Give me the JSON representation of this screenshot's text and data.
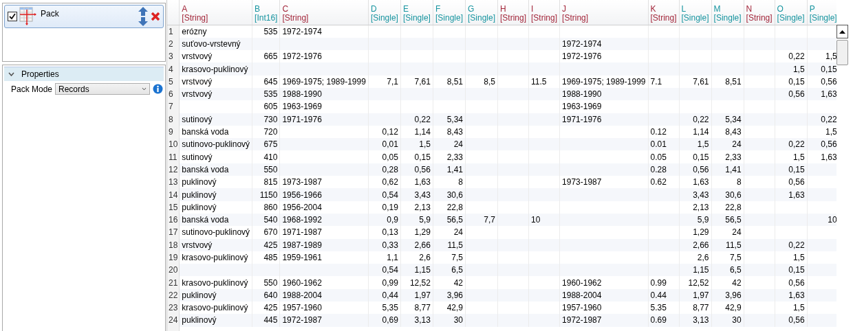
{
  "pack_list": {
    "items": [
      {
        "label": "Pack",
        "checked": true,
        "selected": true
      }
    ]
  },
  "properties": {
    "title": "Properties",
    "expanded": true,
    "fields": [
      {
        "label": "Pack Mode",
        "value": "Records"
      }
    ]
  },
  "table": {
    "columns": [
      {
        "letter": "A",
        "type": "[String]",
        "kind": "string"
      },
      {
        "letter": "B",
        "type": "[Int16]",
        "kind": "number"
      },
      {
        "letter": "C",
        "type": "[String]",
        "kind": "string"
      },
      {
        "letter": "D",
        "type": "[Single]",
        "kind": "number"
      },
      {
        "letter": "E",
        "type": "[Single]",
        "kind": "number"
      },
      {
        "letter": "F",
        "type": "[Single]",
        "kind": "number"
      },
      {
        "letter": "G",
        "type": "[Single]",
        "kind": "number"
      },
      {
        "letter": "H",
        "type": "[String]",
        "kind": "string"
      },
      {
        "letter": "I",
        "type": "[String]",
        "kind": "string"
      },
      {
        "letter": "J",
        "type": "[String]",
        "kind": "string"
      },
      {
        "letter": "K",
        "type": "[String]",
        "kind": "string"
      },
      {
        "letter": "L",
        "type": "[Single]",
        "kind": "number"
      },
      {
        "letter": "M",
        "type": "[Single]",
        "kind": "number"
      },
      {
        "letter": "N",
        "type": "[String]",
        "kind": "string"
      },
      {
        "letter": "O",
        "type": "[Single]",
        "kind": "number"
      },
      {
        "letter": "P",
        "type": "[Single]",
        "kind": "number"
      }
    ],
    "rows": [
      {
        "number": "1",
        "cells": [
          "erózny",
          "535",
          "1972-1974",
          null,
          null,
          null,
          null,
          null,
          null,
          null,
          null,
          null,
          null,
          null,
          null,
          null
        ]
      },
      {
        "number": "2",
        "cells": [
          "suťovo-vrstevný",
          null,
          null,
          null,
          null,
          null,
          null,
          null,
          null,
          "1972-1974",
          null,
          null,
          null,
          null,
          null,
          null
        ]
      },
      {
        "number": "3",
        "cells": [
          "vrstvový",
          "665",
          "1972-1976",
          null,
          null,
          null,
          null,
          null,
          null,
          "1972-1976",
          null,
          null,
          null,
          null,
          "0,22",
          "1,5"
        ]
      },
      {
        "number": "4",
        "cells": [
          "krasovo-puklinový",
          null,
          null,
          null,
          null,
          null,
          null,
          null,
          null,
          null,
          null,
          null,
          null,
          null,
          "1,5",
          "0,15"
        ]
      },
      {
        "number": "5",
        "cells": [
          "vrstvový",
          "645",
          "1969-1975; 1989-1999",
          "7,1",
          "7,61",
          "8,51",
          "8,5",
          null,
          "11.5",
          "1969-1975; 1989-1999",
          "7.1",
          "7,61",
          "8,51",
          null,
          "0,15",
          "0,56"
        ]
      },
      {
        "number": "6",
        "cells": [
          "vrstvový",
          "535",
          "1988-1990",
          null,
          null,
          null,
          null,
          null,
          null,
          "1988-1990",
          null,
          null,
          null,
          null,
          "0,56",
          "1,63"
        ]
      },
      {
        "number": "7",
        "cells": [
          null,
          "605",
          "1963-1969",
          null,
          null,
          null,
          null,
          null,
          null,
          "1963-1969",
          null,
          null,
          null,
          null,
          null,
          null
        ]
      },
      {
        "number": "8",
        "cells": [
          "sutinový",
          "730",
          "1971-1976",
          null,
          "0,22",
          "5,34",
          null,
          null,
          null,
          "1971-1976",
          null,
          "0,22",
          "5,34",
          null,
          null,
          "0,22"
        ]
      },
      {
        "number": "9",
        "cells": [
          "banská voda",
          "720",
          null,
          "0,12",
          "1,14",
          "8,43",
          null,
          null,
          null,
          null,
          "0.12",
          "1,14",
          "8,43",
          null,
          null,
          "1,5"
        ]
      },
      {
        "number": "10",
        "cells": [
          "sutinovo-puklinový",
          "675",
          null,
          "0,01",
          "1,5",
          "24",
          null,
          null,
          null,
          null,
          "0.01",
          "1,5",
          "24",
          null,
          "0,22",
          "0,56"
        ]
      },
      {
        "number": "11",
        "cells": [
          "sutinový",
          "410",
          null,
          "0,05",
          "0,15",
          "2,33",
          null,
          null,
          null,
          null,
          "0.05",
          "0,15",
          "2,33",
          null,
          "1,5",
          "1,63"
        ]
      },
      {
        "number": "12",
        "cells": [
          "banská voda",
          "550",
          null,
          "0,28",
          "0,56",
          "1,41",
          null,
          null,
          null,
          null,
          "0.28",
          "0,56",
          "1,41",
          null,
          "0,15",
          null
        ]
      },
      {
        "number": "13",
        "cells": [
          "puklinový",
          "815",
          "1973-1987",
          "0,62",
          "1,63",
          "8",
          null,
          null,
          null,
          "1973-1987",
          "0.62",
          "1,63",
          "8",
          null,
          "0,56",
          null
        ]
      },
      {
        "number": "14",
        "cells": [
          "puklinový",
          "1150",
          "1956-1966",
          "0,54",
          "3,43",
          "30,6",
          null,
          null,
          null,
          null,
          null,
          "3,43",
          "30,6",
          null,
          "1,63",
          null
        ]
      },
      {
        "number": "15",
        "cells": [
          "puklinový",
          "860",
          "1956-2004",
          "0,19",
          "2,13",
          "22,8",
          null,
          null,
          null,
          null,
          null,
          "2,13",
          "22,8",
          null,
          null,
          null
        ]
      },
      {
        "number": "16",
        "cells": [
          "banská voda",
          "540",
          "1968-1992",
          "0,9",
          "5,9",
          "56,5",
          "7,7",
          null,
          "10",
          null,
          null,
          "5,9",
          "56,5",
          null,
          null,
          "10"
        ]
      },
      {
        "number": "17",
        "cells": [
          "sutinovo-puklinový",
          "670",
          "1971-1987",
          "0,13",
          "1,29",
          "24",
          null,
          null,
          null,
          null,
          null,
          "1,29",
          "24",
          null,
          null,
          null
        ]
      },
      {
        "number": "18",
        "cells": [
          "vrstvový",
          "425",
          "1987-1989",
          "0,33",
          "2,66",
          "11,5",
          null,
          null,
          null,
          null,
          null,
          "2,66",
          "11,5",
          null,
          "0,22",
          null
        ]
      },
      {
        "number": "19",
        "cells": [
          "krasovo-puklinový",
          "485",
          "1959-1961",
          "1,1",
          "2,6",
          "7,5",
          null,
          null,
          null,
          null,
          null,
          "2,6",
          "7,5",
          null,
          "1,5",
          null
        ]
      },
      {
        "number": "20",
        "cells": [
          null,
          null,
          null,
          "0,54",
          "1,15",
          "6,5",
          null,
          null,
          null,
          null,
          null,
          "1,15",
          "6,5",
          null,
          "0,15",
          null
        ]
      },
      {
        "number": "21",
        "cells": [
          "krasovo-puklinový",
          "550",
          "1960-1962",
          "0,99",
          "12,52",
          "42",
          null,
          null,
          null,
          "1960-1962",
          "0.99",
          "12,52",
          "42",
          null,
          "0,56",
          null
        ]
      },
      {
        "number": "22",
        "cells": [
          "puklinový",
          "640",
          "1988-2004",
          "0,44",
          "1,97",
          "3,96",
          null,
          null,
          null,
          "1988-2004",
          "0.44",
          "1,97",
          "3,96",
          null,
          "1,63",
          null
        ]
      },
      {
        "number": "23",
        "cells": [
          "krasovo-puklinový",
          "425",
          "1957-1960",
          "5,35",
          "8,77",
          "42,9",
          null,
          null,
          null,
          "1957-1960",
          "5.35",
          "8,77",
          "42,9",
          null,
          "1,5",
          null
        ]
      },
      {
        "number": "24",
        "cells": [
          "puklinový",
          "445",
          "1972-1987",
          "0,69",
          "3,13",
          "30",
          null,
          null,
          null,
          "1972-1987",
          "0.69",
          "3,13",
          "30",
          null,
          "0,56",
          null
        ]
      }
    ]
  }
}
